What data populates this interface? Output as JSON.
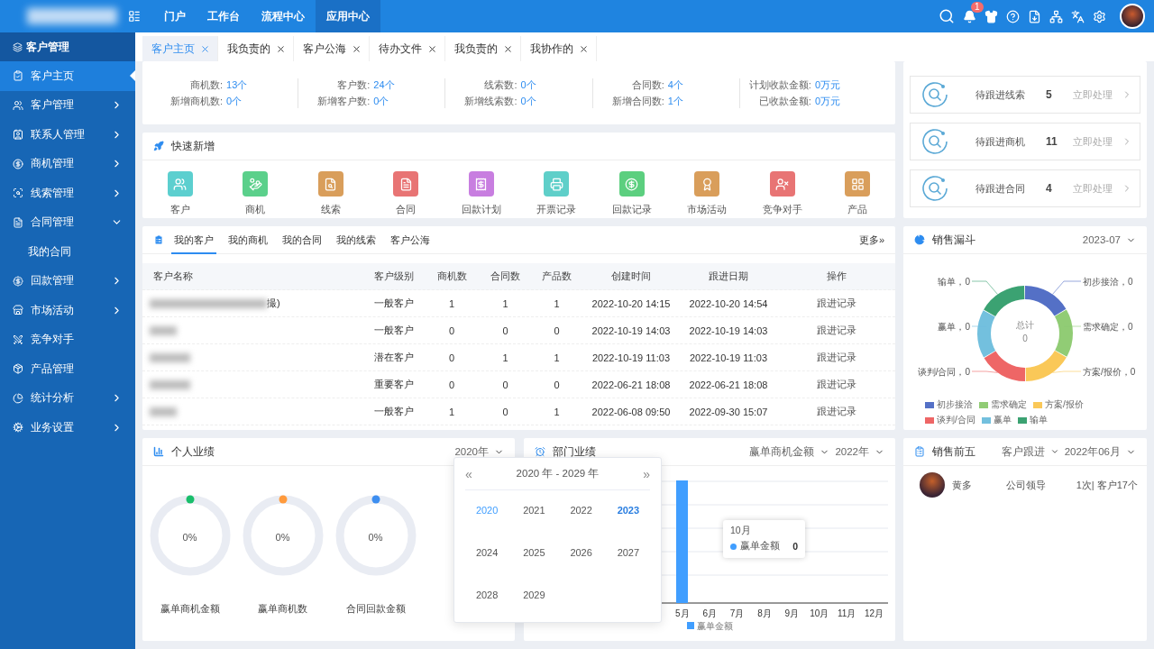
{
  "topbar": {
    "nav": [
      {
        "label": "门户",
        "selected": false
      },
      {
        "label": "工作台",
        "selected": false
      },
      {
        "label": "流程中心",
        "selected": false
      },
      {
        "label": "应用中心",
        "selected": true
      }
    ],
    "notification_count": "1"
  },
  "sidebar": {
    "title": "客户管理",
    "items": [
      {
        "label": "客户主页",
        "selected": true
      },
      {
        "label": "客户管理",
        "selected": false,
        "expanded": false
      },
      {
        "label": "联系人管理",
        "selected": false,
        "expanded": false
      },
      {
        "label": "商机管理",
        "selected": false,
        "expanded": false
      },
      {
        "label": "线索管理",
        "selected": false,
        "expanded": false
      },
      {
        "label": "合同管理",
        "selected": false,
        "expanded": true,
        "children": [
          {
            "label": "我的合同",
            "selected": false
          }
        ]
      },
      {
        "label": "回款管理",
        "selected": false,
        "expanded": false
      },
      {
        "label": "市场活动",
        "selected": false,
        "expanded": false
      },
      {
        "label": "竞争对手",
        "selected": false
      },
      {
        "label": "产品管理",
        "selected": false
      },
      {
        "label": "统计分析",
        "selected": false,
        "expanded": false
      },
      {
        "label": "业务设置",
        "selected": false,
        "expanded": false
      }
    ]
  },
  "tabs": [
    {
      "label": "客户主页",
      "selected": true
    },
    {
      "label": "我负责的",
      "selected": false
    },
    {
      "label": "客户公海",
      "selected": false
    },
    {
      "label": "待办文件",
      "selected": false
    },
    {
      "label": "我负责的",
      "selected": false
    },
    {
      "label": "我协作的",
      "selected": false
    }
  ],
  "stats": [
    {
      "items": [
        {
          "label": "商机数:",
          "value": "13个"
        },
        {
          "label": "新增商机数:",
          "value": "0个"
        }
      ]
    },
    {
      "items": [
        {
          "label": "客户数:",
          "value": "24个"
        },
        {
          "label": "新增客户数:",
          "value": "0个"
        }
      ]
    },
    {
      "items": [
        {
          "label": "线索数:",
          "value": "0个"
        },
        {
          "label": "新增线索数:",
          "value": "0个"
        }
      ]
    },
    {
      "items": [
        {
          "label": "合同数:",
          "value": "4个"
        },
        {
          "label": "新增合同数:",
          "value": "1个"
        }
      ]
    },
    {
      "items": [
        {
          "label": "计划收款金额:",
          "value": "0万元"
        },
        {
          "label": "已收款金额:",
          "value": "0万元"
        }
      ]
    }
  ],
  "quick_add": {
    "title": "快速新增",
    "items": [
      "客户",
      "商机",
      "线索",
      "合同",
      "回款计划",
      "开票记录",
      "回款记录",
      "市场活动",
      "竞争对手",
      "产品"
    ]
  },
  "customers": {
    "tabs": [
      {
        "label": "我的客户",
        "selected": true
      },
      {
        "label": "我的商机",
        "selected": false
      },
      {
        "label": "我的合同",
        "selected": false
      },
      {
        "label": "我的线索",
        "selected": false
      },
      {
        "label": "客户公海",
        "selected": false
      }
    ],
    "more": "更多»",
    "columns": [
      "客户名称",
      "客户级别",
      "商机数",
      "合同数",
      "产品数",
      "创建时间",
      "跟进日期",
      "操作"
    ],
    "rows": [
      {
        "cells": [
          "撮)",
          "一般客户",
          "1",
          "1",
          "1",
          "2022-10-20 14:15",
          "2022-10-20 14:54",
          "跟进记录"
        ]
      },
      {
        "cells": [
          "",
          "一般客户",
          "0",
          "0",
          "0",
          "2022-10-19 14:03",
          "2022-10-19 14:03",
          "跟进记录"
        ]
      },
      {
        "cells": [
          "",
          "潜在客户",
          "0",
          "1",
          "1",
          "2022-10-19 11:03",
          "2022-10-19 11:03",
          "跟进记录"
        ]
      },
      {
        "cells": [
          "",
          "重要客户",
          "0",
          "0",
          "0",
          "2022-06-21 18:08",
          "2022-06-21 18:08",
          "跟进记录"
        ]
      },
      {
        "cells": [
          "",
          "一般客户",
          "1",
          "0",
          "1",
          "2022-06-08 09:50",
          "2022-09-30 15:07",
          "跟进记录"
        ]
      }
    ]
  },
  "followups": [
    {
      "label": "待跟进线索",
      "count": "5",
      "action": "立即处理"
    },
    {
      "label": "待跟进商机",
      "count": "11",
      "action": "立即处理"
    },
    {
      "label": "待跟进合同",
      "count": "4",
      "action": "立即处理"
    }
  ],
  "funnel": {
    "title": "销售漏斗",
    "period": "2023-07",
    "total_label": "总计",
    "total": "0",
    "callouts": [
      "输单，0",
      "初步接洽，0",
      "赢单，0",
      "需求确定，0",
      "谈判/合同，0",
      "方案/报价，0"
    ],
    "segments": [
      {
        "label": "初步接洽",
        "color": "#5470c6"
      },
      {
        "label": "需求确定",
        "color": "#91cc75"
      },
      {
        "label": "方案/报价",
        "color": "#fac858"
      },
      {
        "label": "谈判/合同",
        "color": "#ee6666"
      },
      {
        "label": "赢单",
        "color": "#73c0de"
      },
      {
        "label": "输单",
        "color": "#3ba272"
      }
    ]
  },
  "personal": {
    "title": "个人业绩",
    "year": "2020年",
    "gauges": [
      {
        "percent": "0%",
        "label": "赢单商机金额",
        "color": "#19be6b"
      },
      {
        "percent": "0%",
        "label": "赢单商机数",
        "color": "#ff9a3c"
      },
      {
        "percent": "0%",
        "label": "合同回款金额",
        "color": "#3d8ef0"
      }
    ],
    "picker": {
      "range": "2020 年 - 2029 年",
      "prev": "«",
      "next": "»",
      "years": [
        {
          "label": "2020",
          "selected": true,
          "current": false
        },
        {
          "label": "2021",
          "selected": false,
          "current": false
        },
        {
          "label": "2022",
          "selected": false,
          "current": false
        },
        {
          "label": "2023",
          "selected": false,
          "current": true
        },
        {
          "label": "2024",
          "selected": false,
          "current": false
        },
        {
          "label": "2025",
          "selected": false,
          "current": false
        },
        {
          "label": "2026",
          "selected": false,
          "current": false
        },
        {
          "label": "2027",
          "selected": false,
          "current": false
        },
        {
          "label": "2028",
          "selected": false,
          "current": false
        },
        {
          "label": "2029",
          "selected": false,
          "current": false
        }
      ]
    }
  },
  "department": {
    "title": "部门业绩",
    "metric": "赢单商机金额",
    "year": "2022年",
    "months": [
      "5月",
      "6月",
      "7月",
      "8月",
      "9月",
      "10月",
      "11月",
      "12月"
    ],
    "legend": "赢单金额",
    "tooltip": {
      "title": "10月",
      "series": "赢单金额",
      "value": "0"
    }
  },
  "top5": {
    "title": "销售前五",
    "filter": "客户跟进",
    "period": "2022年06月",
    "rows": [
      {
        "name": "黄多",
        "role": "公司领导",
        "summary": "1次| 客户17个"
      }
    ]
  }
}
